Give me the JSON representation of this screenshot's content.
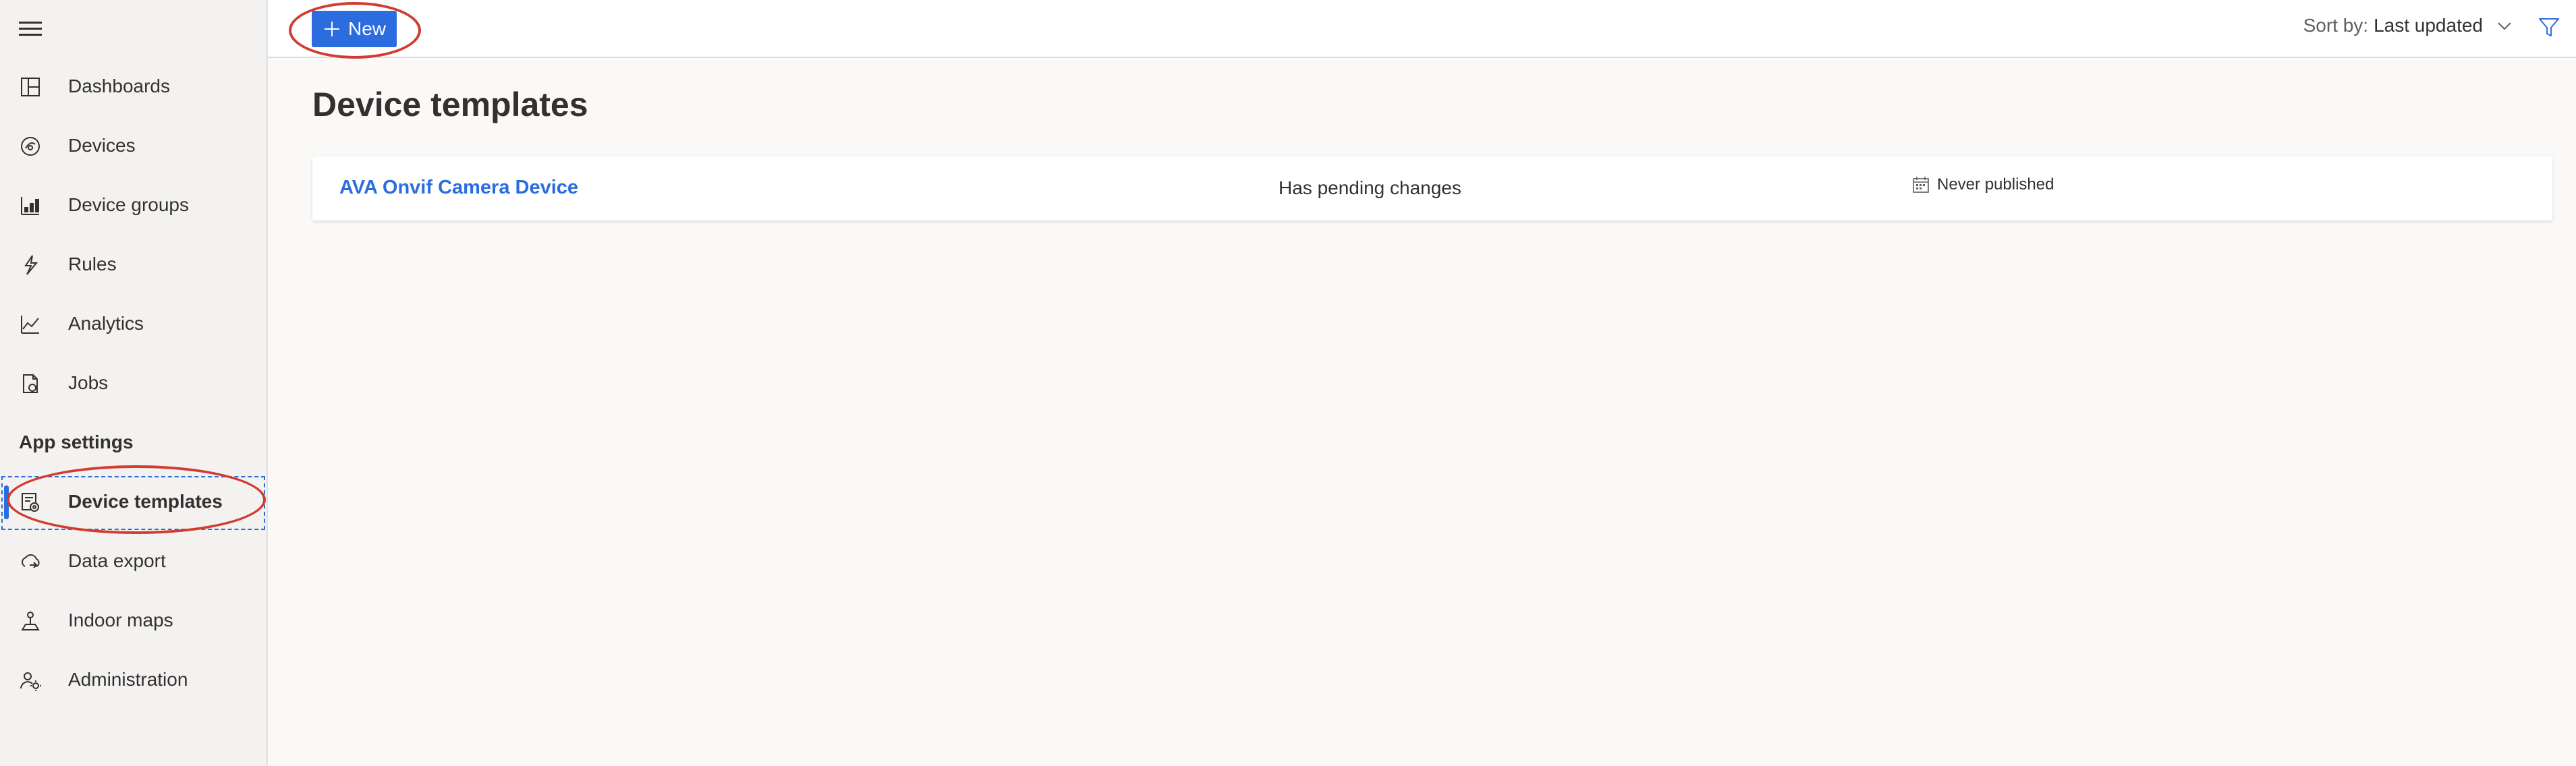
{
  "sidebar": {
    "items": [
      {
        "label": "Dashboards",
        "icon": "dashboard-icon"
      },
      {
        "label": "Devices",
        "icon": "device-icon"
      },
      {
        "label": "Device groups",
        "icon": "device-groups-icon"
      },
      {
        "label": "Rules",
        "icon": "rules-icon"
      },
      {
        "label": "Analytics",
        "icon": "analytics-icon"
      },
      {
        "label": "Jobs",
        "icon": "jobs-icon"
      }
    ],
    "section_heading": "App settings",
    "settings_items": [
      {
        "label": "Device templates",
        "icon": "device-templates-icon",
        "active": true
      },
      {
        "label": "Data export",
        "icon": "data-export-icon"
      },
      {
        "label": "Indoor maps",
        "icon": "indoor-maps-icon"
      },
      {
        "label": "Administration",
        "icon": "administration-icon"
      }
    ]
  },
  "toolbar": {
    "new_label": "New",
    "sort_prefix": "Sort by:",
    "sort_value": "Last updated"
  },
  "main": {
    "title": "Device templates",
    "templates": [
      {
        "name": "AVA Onvif Camera Device",
        "status": "Has pending changes",
        "published": "Never published"
      }
    ]
  },
  "colors": {
    "accent": "#2b6cde",
    "annotation": "#d13c30",
    "sidebar_bg": "#f3f2f1",
    "page_bg": "#faf9f8"
  }
}
